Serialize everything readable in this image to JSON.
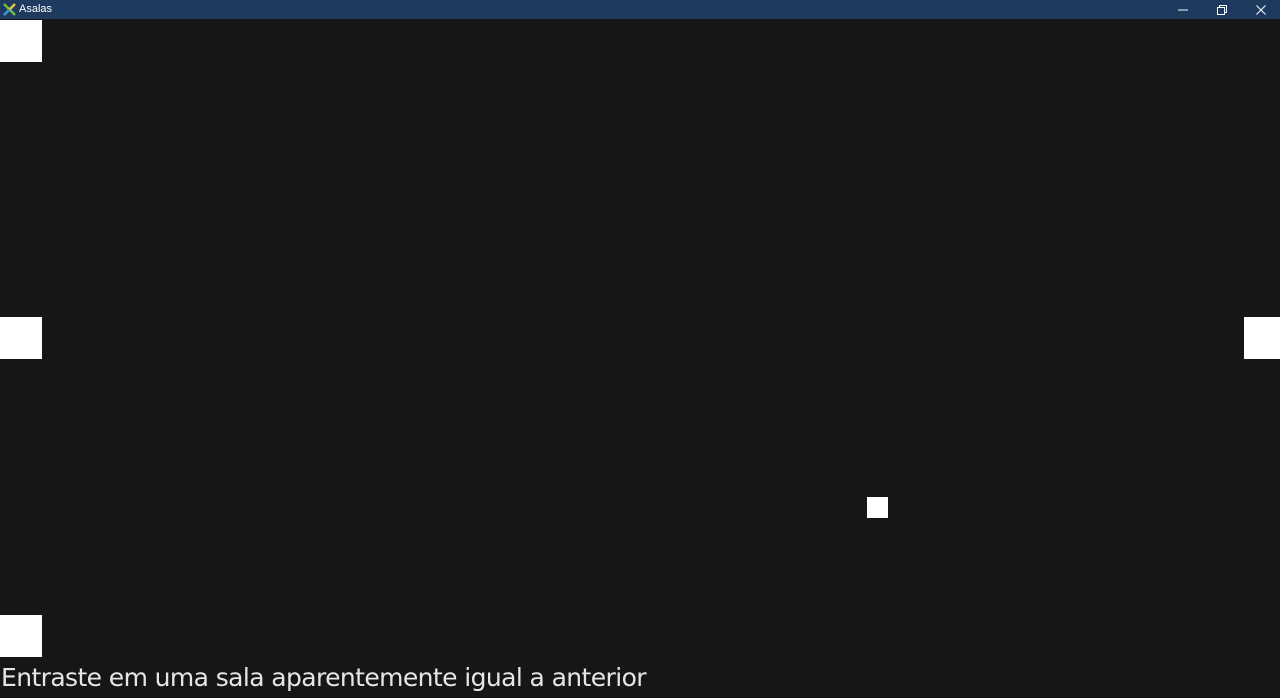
{
  "window": {
    "title": "Asalas",
    "app_icon": "x-app-icon",
    "controls": {
      "minimize_icon": "minimize-icon",
      "maximize_icon": "restore-icon",
      "close_icon": "close-icon"
    },
    "titlebar_color": "#1e3a5f"
  },
  "game": {
    "background_color": "#161616",
    "block_color": "#ffffff",
    "message": "Entraste em uma sala aparentemente igual a anterior"
  }
}
